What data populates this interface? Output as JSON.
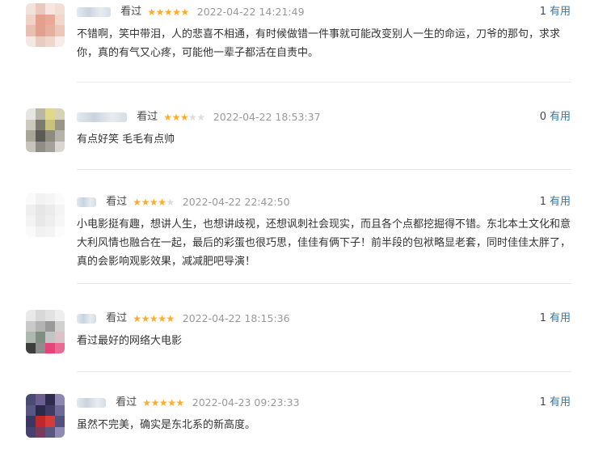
{
  "reviews": [
    {
      "status": "看过",
      "rating": 5,
      "time": "2022-04-22 14:21:49",
      "useful_count": "1",
      "useful_label": "有用",
      "content": "不错啊，笑中带泪，人的悲喜不相通，有时候做错一件事就可能改变别人一生的命运，刀爷的那句，求求你，真的有气又心疼，可能他一辈子都活在自责中。"
    },
    {
      "status": "看过",
      "rating": 3,
      "time": "2022-04-22 18:53:37",
      "useful_count": "0",
      "useful_label": "有用",
      "content": "有点好笑 毛毛有点帅"
    },
    {
      "status": "看过",
      "rating": 4,
      "time": "2022-04-22 22:42:50",
      "useful_count": "1",
      "useful_label": "有用",
      "content": "小电影挺有趣，想讲人生，也想讲歧视，还想讽刺社会现实，而且各个点都挖掘得不错。东北本土文化和意大利风情也融合在一起，最后的彩蛋也很巧思，佳佳有俩下子！前半段的包袱略显老套，同时佳佳太胖了，真的会影响观影效果，减减肥吧导演！"
    },
    {
      "status": "看过",
      "rating": 5,
      "time": "2022-04-22 18:15:36",
      "useful_count": "1",
      "useful_label": "有用",
      "content": "看过最好的网络大电影"
    },
    {
      "status": "看过",
      "rating": 5,
      "time": "2022-04-23 09:23:33",
      "useful_count": "1",
      "useful_label": "有用",
      "content": "虽然不完美，确实是东北系的新高度。"
    }
  ],
  "colors": {
    "star_on": "#ffac2d",
    "star_off": "#dddddd",
    "time": "#999999",
    "useful_link": "#3377aa",
    "text": "#333333"
  }
}
